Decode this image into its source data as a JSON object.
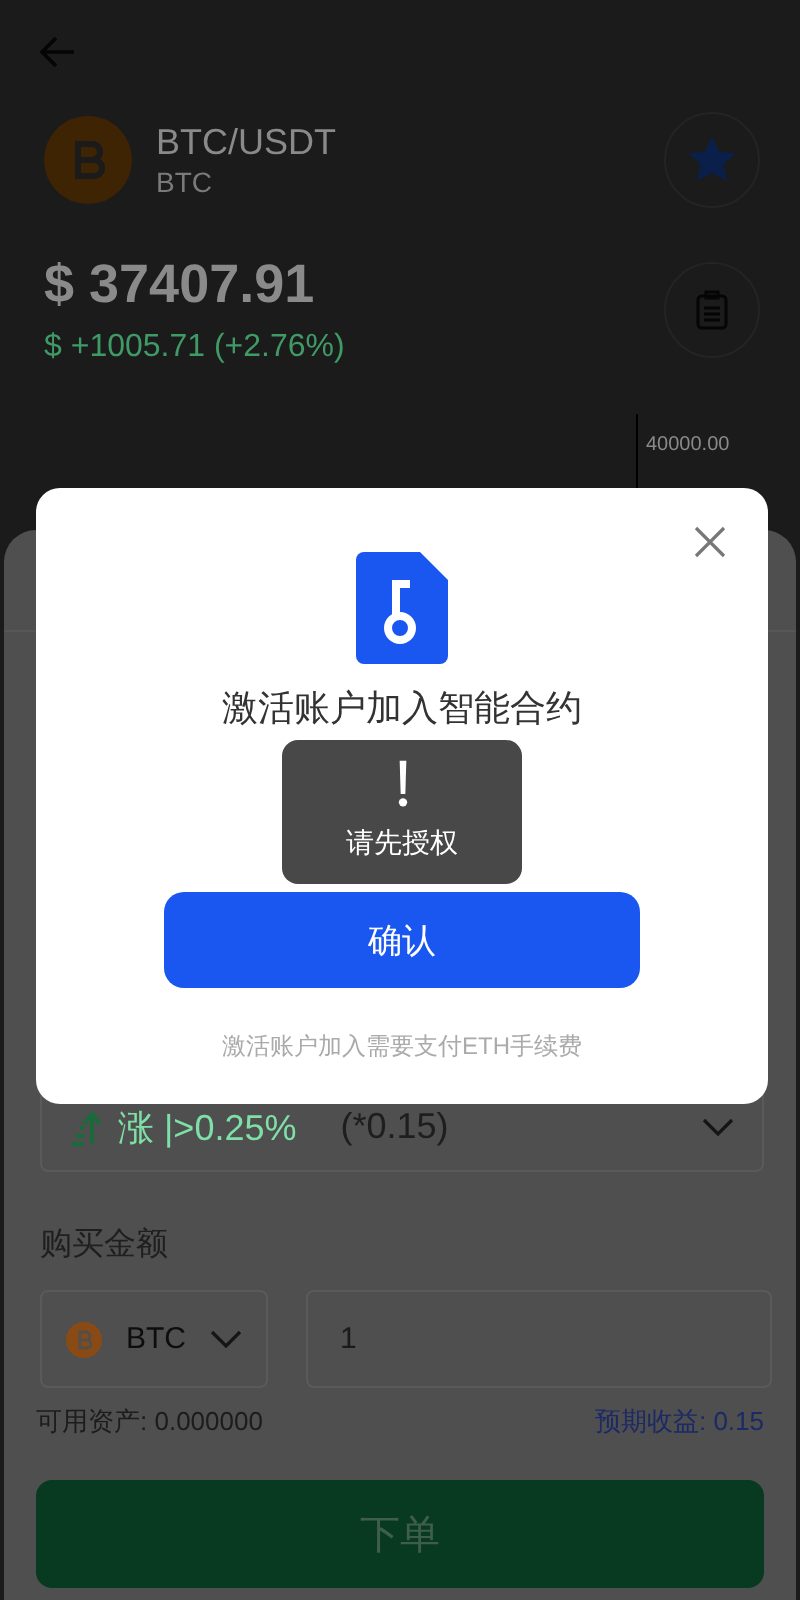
{
  "pair": {
    "symbol": "BTC/USDT",
    "base": "BTC",
    "price": "$ 37407.91",
    "change": "$ +1005.71 (+2.76%)",
    "favorite": true
  },
  "chart": {
    "axis_label": "40000.00"
  },
  "order": {
    "direction": {
      "label": "涨 |>0.25%",
      "rate": "(*0.15)"
    },
    "amount_label": "购买金额",
    "coin": "BTC",
    "amount": "1",
    "available": "可用资产: 0.000000",
    "expected": "预期收益: 0.15",
    "submit": "下单"
  },
  "dialog": {
    "title": "激活账户加入智能合约",
    "confirm": "确认",
    "note": "激活账户加入需要支付ETH手续费"
  },
  "toast": {
    "message": "请先授权"
  }
}
